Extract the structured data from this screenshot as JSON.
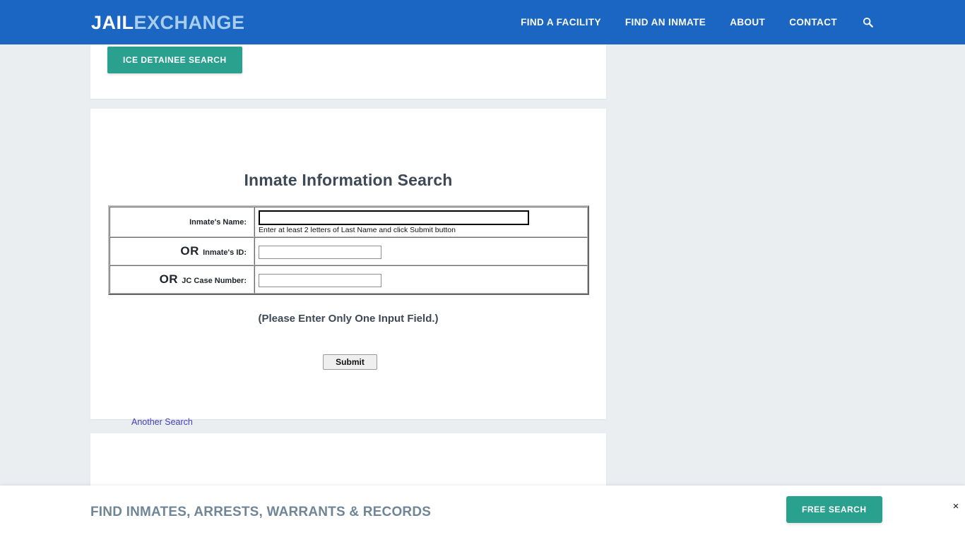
{
  "header": {
    "logo_primary": "JAIL",
    "logo_secondary": "EXCHANGE",
    "brand_color": "#1a66c2",
    "nav": [
      {
        "label": "FIND A FACILITY"
      },
      {
        "label": "FIND AN INMATE"
      },
      {
        "label": "ABOUT"
      },
      {
        "label": "CONTACT"
      }
    ],
    "search_icon": "search-icon"
  },
  "top_card": {
    "ice_button_label": "ICE DETAINEE SEARCH",
    "accent_color": "#2aa08f"
  },
  "search_card": {
    "title": "Inmate Information Search",
    "rows": [
      {
        "or_prefix": "",
        "label": "Inmate's Name:",
        "value": "",
        "hint": "Enter at least 2 letters of Last Name and click Submit button"
      },
      {
        "or_prefix": "OR ",
        "label": "Inmate's ID:",
        "value": "",
        "hint": ""
      },
      {
        "or_prefix": "OR ",
        "label": "JC Case Number:",
        "value": "",
        "hint": ""
      }
    ],
    "note": "(Please Enter Only One Input Field.)",
    "submit_label": "Submit",
    "another_search_label": "Another Search",
    "link_color": "#4340b8"
  },
  "bottom_bar": {
    "title": "FIND INMATES, ARRESTS, WARRANTS & RECORDS",
    "free_search_label": "FREE SEARCH",
    "close_label": "×",
    "title_color": "#708596",
    "accent_color": "#2aa08f"
  }
}
